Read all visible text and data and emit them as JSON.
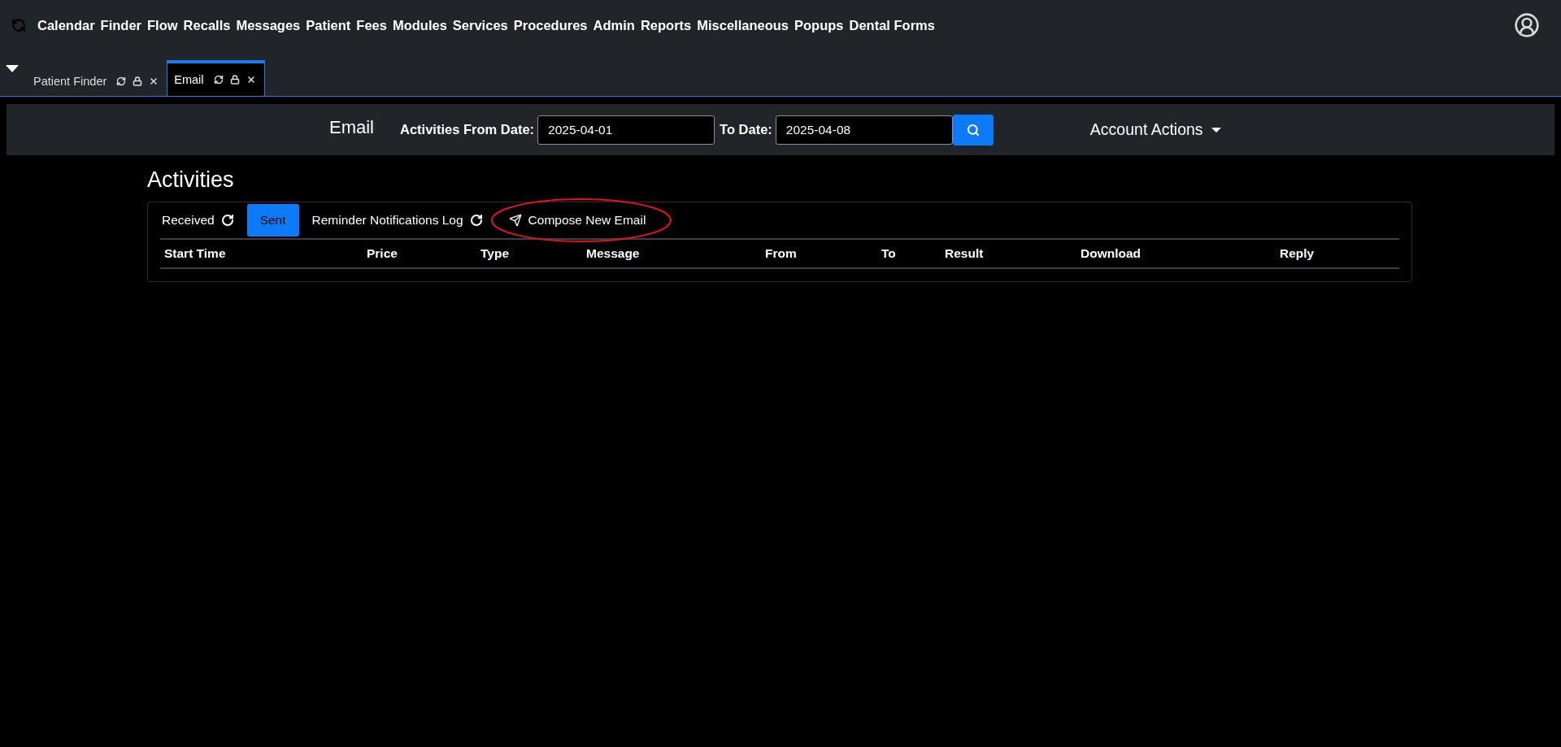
{
  "menu": [
    "Calendar",
    "Finder",
    "Flow",
    "Recalls",
    "Messages",
    "Patient",
    "Fees",
    "Modules",
    "Services",
    "Procedures",
    "Admin",
    "Reports",
    "Miscellaneous",
    "Popups",
    "Dental Forms"
  ],
  "tabs": [
    {
      "label": "Patient Finder",
      "selected": false
    },
    {
      "label": "Email",
      "selected": true
    }
  ],
  "toolbar": {
    "title": "Email",
    "from_label": "Activities From Date:",
    "from_value": "2025-04-01",
    "to_label": "To Date:",
    "to_value": "2025-04-08",
    "account_actions": "Account Actions"
  },
  "activities": {
    "heading": "Activities",
    "tabs": [
      {
        "label": "Received",
        "kind": "refresh",
        "selected": false
      },
      {
        "label": "Sent",
        "kind": "plain",
        "selected": true
      },
      {
        "label": "Reminder Notifications Log",
        "kind": "refresh",
        "selected": false
      },
      {
        "label": "Compose New Email",
        "kind": "compose",
        "selected": false
      }
    ],
    "columns": [
      "Start Time",
      "Price",
      "Type",
      "Message",
      "From",
      "To",
      "Result",
      "Download",
      "Reply"
    ]
  }
}
